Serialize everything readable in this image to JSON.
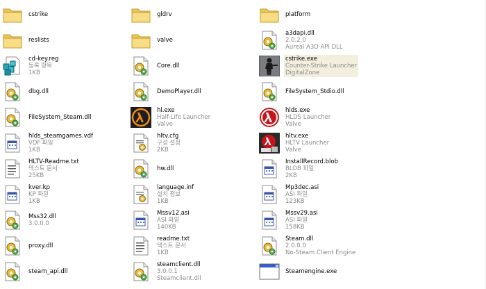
{
  "items": [
    {
      "name": "cstrike",
      "icon": "folder-icon"
    },
    {
      "name": "gldrv",
      "icon": "folder-icon"
    },
    {
      "name": "platform",
      "icon": "folder-icon"
    },
    {
      "name": "reslists",
      "icon": "folder-icon"
    },
    {
      "name": "valve",
      "icon": "folder-icon"
    },
    {
      "name": "a3dapi.dll",
      "line2": "2.0.2.0",
      "line3": "Aureal A3D API DLL",
      "icon": "dll-gear-icon"
    },
    {
      "name": "cd-key.reg",
      "line2": "등록 항목",
      "line3": "1KB",
      "icon": "registry-cubes-icon"
    },
    {
      "name": "Core.dll",
      "icon": "dll-gear-icon"
    },
    {
      "name": "cstrike.exe",
      "line2": "Counter-Strike Launcher",
      "line3": "DigitalZone",
      "icon": "counter-strike-icon",
      "selected": true
    },
    {
      "name": "dbg.dll",
      "icon": "dll-gear-icon"
    },
    {
      "name": "DemoPlayer.dll",
      "icon": "dll-gear-icon"
    },
    {
      "name": "FileSystem_Stdio.dll",
      "icon": "dll-gear-icon"
    },
    {
      "name": "FileSystem_Steam.dll",
      "icon": "dll-gear-icon"
    },
    {
      "name": "hl.exe",
      "line2": "Half-Life Launcher",
      "line3": "Valve",
      "icon": "half-life-icon"
    },
    {
      "name": "hlds.exe",
      "line2": "HLDS Launcher",
      "line3": "Valve",
      "icon": "hlds-icon"
    },
    {
      "name": "hlds_steamgames.vdf",
      "line2": "VDF 파일",
      "line3": "1KB",
      "icon": "generic-file-icon"
    },
    {
      "name": "hltv.cfg",
      "line2": "구성 설정",
      "line3": "2KB",
      "icon": "config-file-icon"
    },
    {
      "name": "hltv.exe",
      "line2": "HLTV Launcher",
      "line3": "Valve",
      "icon": "hltv-icon"
    },
    {
      "name": "HLTV-Readme.txt",
      "line2": "텍스트 문서",
      "line3": "25KB",
      "icon": "text-document-icon"
    },
    {
      "name": "hw.dll",
      "icon": "dll-gear-icon"
    },
    {
      "name": "InstallRecord.blob",
      "line2": "BLOB 파일",
      "line3": "2KB",
      "icon": "generic-file-icon"
    },
    {
      "name": "kver.kp",
      "line2": "KP 파일",
      "line3": "1KB",
      "icon": "generic-file-icon"
    },
    {
      "name": "language.inf",
      "line2": "설치 정보",
      "line3": "1KB",
      "icon": "config-file-icon"
    },
    {
      "name": "Mp3dec.asi",
      "line2": "ASI 파일",
      "line3": "123KB",
      "icon": "generic-file-icon"
    },
    {
      "name": "Mss32.dll",
      "line2": "3.0.0.0",
      "icon": "dll-gear-icon"
    },
    {
      "name": "Mssv12.asi",
      "line2": "ASI 파일",
      "line3": "140KB",
      "icon": "generic-file-icon"
    },
    {
      "name": "Mssv29.asi",
      "line2": "ASI 파일",
      "line3": "158KB",
      "icon": "generic-file-icon"
    },
    {
      "name": "proxy.dll",
      "icon": "dll-gear-icon"
    },
    {
      "name": "readme.txt",
      "line2": "텍스트 문서",
      "line3": "1KB",
      "icon": "text-document-icon"
    },
    {
      "name": "Steam.dll",
      "line2": "2.0.0.0",
      "line3": "No-Steam Client Engine",
      "icon": "dll-gear-icon"
    },
    {
      "name": "steam_api.dll",
      "icon": "dll-gear-icon"
    },
    {
      "name": "steamclient.dll",
      "line2": "3.0.0.1",
      "line3": "Steamclient.dll",
      "icon": "dll-gear-icon"
    },
    {
      "name": "Steamengine.exe",
      "icon": "application-window-icon"
    }
  ]
}
